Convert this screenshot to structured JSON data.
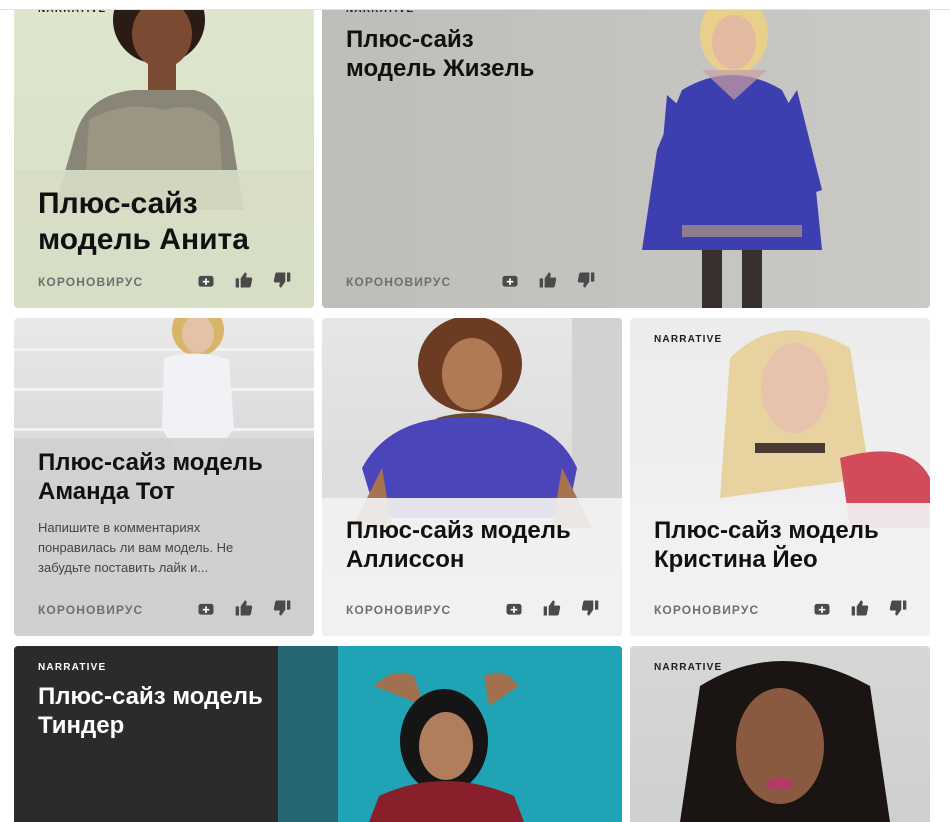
{
  "cards": [
    {
      "kicker": "NARRATIVE",
      "title": "Плюс-сайз модель Анита",
      "tag": "КОРОНОВИРУС"
    },
    {
      "kicker": "NARRATIVE",
      "title": "Плюс-сайз модель Жизель",
      "tag": "КОРОНОВИРУС"
    },
    {
      "title": "Плюс-сайз модель Аманда Тот",
      "description": "Напишите в комментариях понравилась ли вам модель. Не забудьте поставить лайк и...",
      "tag": "КОРОНОВИРУС"
    },
    {
      "title": "Плюс-сайз модель Аллиссон",
      "tag": "КОРОНОВИРУС"
    },
    {
      "kicker": "NARRATIVE",
      "title": "Плюс-сайз модель Кристина Йео",
      "tag": "КОРОНОВИРУС"
    },
    {
      "kicker": "NARRATIVE",
      "title": "Плюс-сайз модель Тиндер"
    },
    {
      "kicker": "NARRATIVE"
    }
  ],
  "icons": {
    "add": "add-to-collection-icon",
    "like": "thumbs-up-icon",
    "dislike": "thumbs-down-icon"
  }
}
